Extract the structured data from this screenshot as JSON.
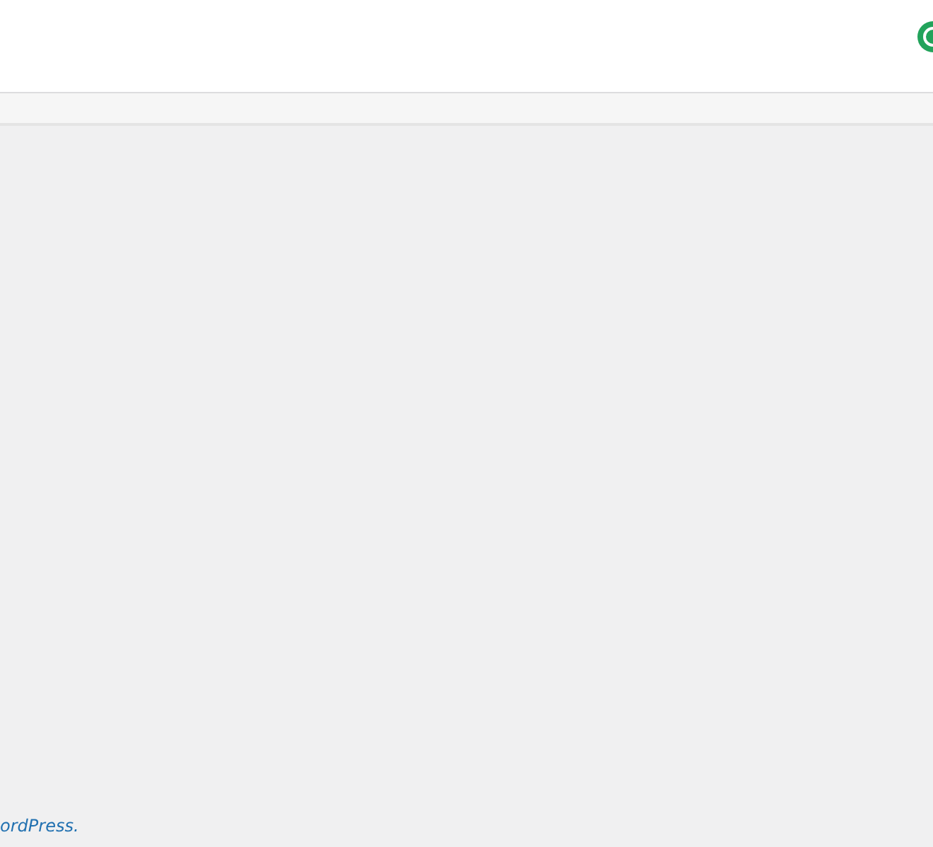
{
  "footer": {
    "link": "ordPress."
  }
}
